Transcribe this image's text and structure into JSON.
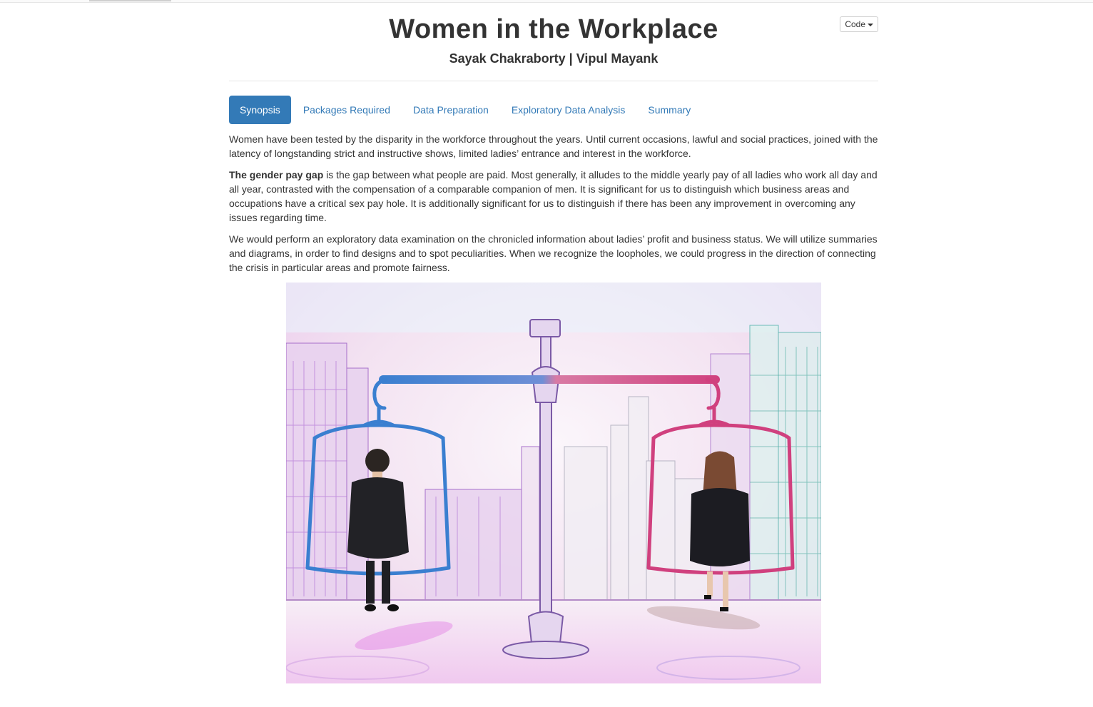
{
  "header": {
    "title": "Women in the Workplace",
    "subtitle": "Sayak Chakraborty | Vipul Mayank",
    "code_button_label": "Code"
  },
  "nav": {
    "tabs": [
      {
        "label": "Synopsis",
        "active": true
      },
      {
        "label": "Packages Required",
        "active": false
      },
      {
        "label": "Data Preparation",
        "active": false
      },
      {
        "label": "Exploratory Data Analysis",
        "active": false
      },
      {
        "label": "Summary",
        "active": false
      }
    ]
  },
  "synopsis": {
    "paragraph1": "Women have been tested by the disparity in the workforce throughout the years. Until current occasions, lawful and social practices, joined with the latency of longstanding strict and instructive shows, limited ladies’ entrance and interest in the workforce.",
    "paragraph2_bold": "The gender pay gap",
    "paragraph2_rest": " is the gap between what people are paid. Most generally, it alludes to the middle yearly pay of all ladies who work all day and all year, contrasted with the compensation of a comparable companion of men. It is significant for us to distinguish which business areas and occupations have a critical sex pay hole. It is additionally significant for us to distinguish if there has been any improvement in overcoming any issues regarding time.",
    "paragraph3": "We would perform an exploratory data examination on the chronicled information about ladies’ profit and business status. We will utilize summaries and diagrams, in order to find designs and to spot peculiarities. When we recognize the loopholes, we could progress in the direction of connecting the crisis in particular areas and promote fairness."
  },
  "colors": {
    "accent": "#337ab7",
    "text": "#333333",
    "scale_blue": "#3a7fd0",
    "scale_pink": "#d0407e",
    "pillar_purple": "#8a6bb0"
  }
}
